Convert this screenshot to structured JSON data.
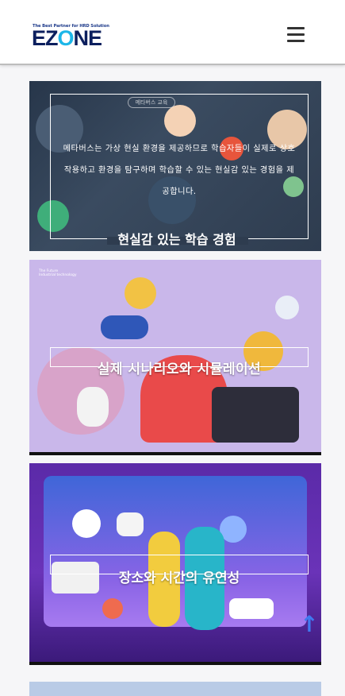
{
  "header": {
    "logo_tagline": "The Best Partner for HRD Solution",
    "logo_text_prefix": "EZ",
    "logo_text_o": "O",
    "logo_text_suffix": "NE"
  },
  "cards": [
    {
      "badge": "메타버스 교육",
      "body": "메타버스는 가상 현실 환경을 제공하므로 학습자들이 실제로 상호 작용하고 환경을 탐구하며 학습할 수 있는 현실감 있는 경험을 제공합니다.",
      "title": "현실감 있는 학습 경험"
    },
    {
      "corner_text_1": "The Future",
      "corner_text_2": "Industrial technology",
      "title": "실제 시나리오와 시뮬레이션"
    },
    {
      "title": "장소와 시간의 유연성"
    }
  ],
  "scroll_top_icon": "arrow-up-icon"
}
